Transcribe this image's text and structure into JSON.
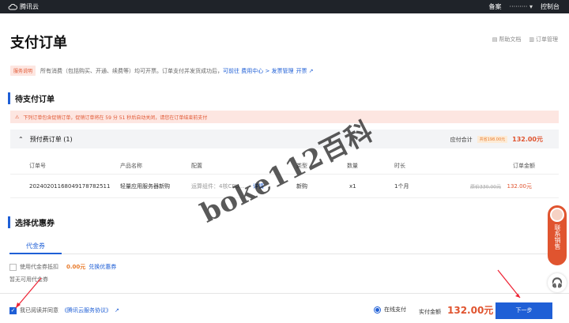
{
  "topbar": {
    "brand": "腾讯云",
    "filing": "备案",
    "user": "·········",
    "console": "控制台"
  },
  "page": {
    "title": "支付订单",
    "help_docs": "帮助文档",
    "order_mgmt": "订单管理"
  },
  "notice": {
    "tag": "服务说明",
    "text": "所有消费（包括购买、开通、续费等）均可开票。订单支付并发货成功后，",
    "link1": "可前往 费用中心 > 发票管理",
    "link2": "开票"
  },
  "pending": {
    "section_title": "待支付订单",
    "warning": "下列订单包含促销订单，促销订单将在 59 分 51 秒后自动关闭，请您在订单结束前支付",
    "group_title": "预付费订单 (1)",
    "total_label": "应付合计",
    "saved": "共省198.00元",
    "total": "132.00元"
  },
  "table": {
    "headers": [
      "订单号",
      "产品名称",
      "配置",
      "类型",
      "数量",
      "时长",
      "订单金额"
    ],
    "row": {
      "order_no": "20240201168049178782511",
      "product": "轻量应用服务器新购",
      "config": "运算组件：4核CPU...",
      "detail": "详情",
      "type": "新购",
      "qty": "x1",
      "duration": "1个月",
      "orig_price": "原价330.00元",
      "price": "132.00元"
    }
  },
  "coupon": {
    "section_title": "选择优惠券",
    "tab": "代金券",
    "use_label": "使用代金券抵扣",
    "amount": "0.00元",
    "redeem": "兑换优惠券",
    "empty": "暂无可用代金券"
  },
  "bottom": {
    "agree_prefix": "我已阅读并同意",
    "agreement": "《腾讯云服务协议》",
    "pay_method": "在线支付",
    "pay_amount_label": "实付金额",
    "pay_amount": "132.00元",
    "next": "下一步"
  },
  "float": {
    "contact": "联系销售"
  },
  "watermark": "boke112百科",
  "colors": {
    "accent": "#1f5fd6",
    "price": "#e0542f",
    "topbar": "#1f2329"
  }
}
